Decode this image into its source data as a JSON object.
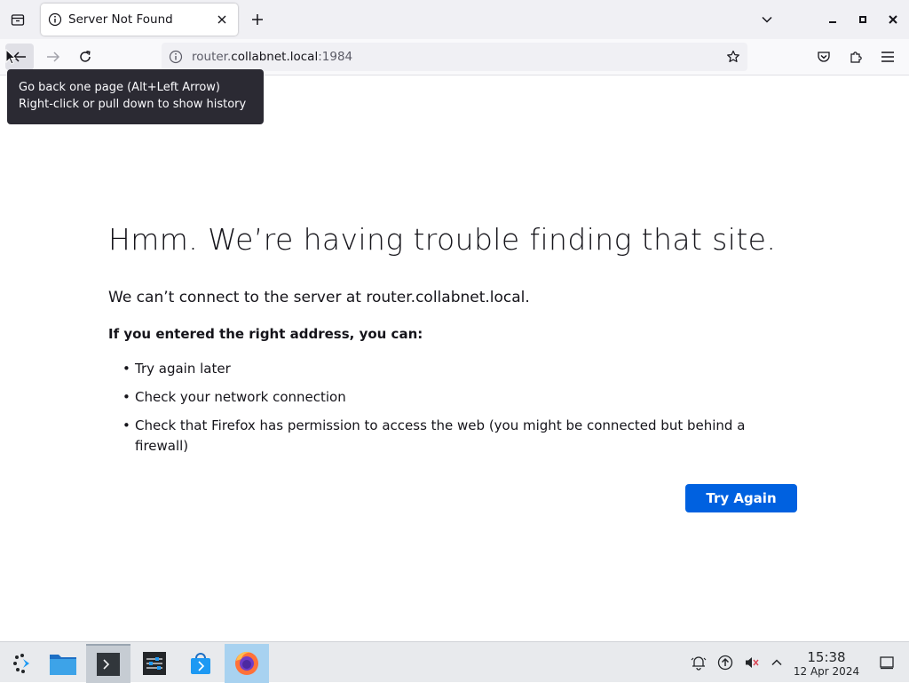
{
  "browser": {
    "tab": {
      "title": "Server Not Found",
      "icon": "info-icon"
    },
    "url": {
      "host": "router.",
      "domain": "collabnet.local",
      "port": ":1984"
    },
    "tooltip": {
      "line1": "Go back one page (Alt+Left Arrow)",
      "line2": "Right-click or pull down to show history"
    }
  },
  "error": {
    "title": "Hmm. We’re having trouble finding that site.",
    "description": "We can’t connect to the server at router.collabnet.local.",
    "subheading": "If you entered the right address, you can:",
    "items": [
      "Try again later",
      "Check your network connection",
      "Check that Firefox has permission to access the web (you might be connected but behind a firewall)"
    ],
    "button": "Try Again"
  },
  "taskbar": {
    "apps": [
      "app-launcher-icon",
      "file-manager-icon",
      "terminal-icon",
      "settings-icon",
      "store-icon",
      "firefox-icon"
    ],
    "clock": {
      "time": "15:38",
      "date": "12 Apr 2024"
    }
  },
  "colors": {
    "accent": "#0061e0",
    "tooltip_bg": "#2b2a33",
    "tab_strip": "#f0f0f4"
  }
}
